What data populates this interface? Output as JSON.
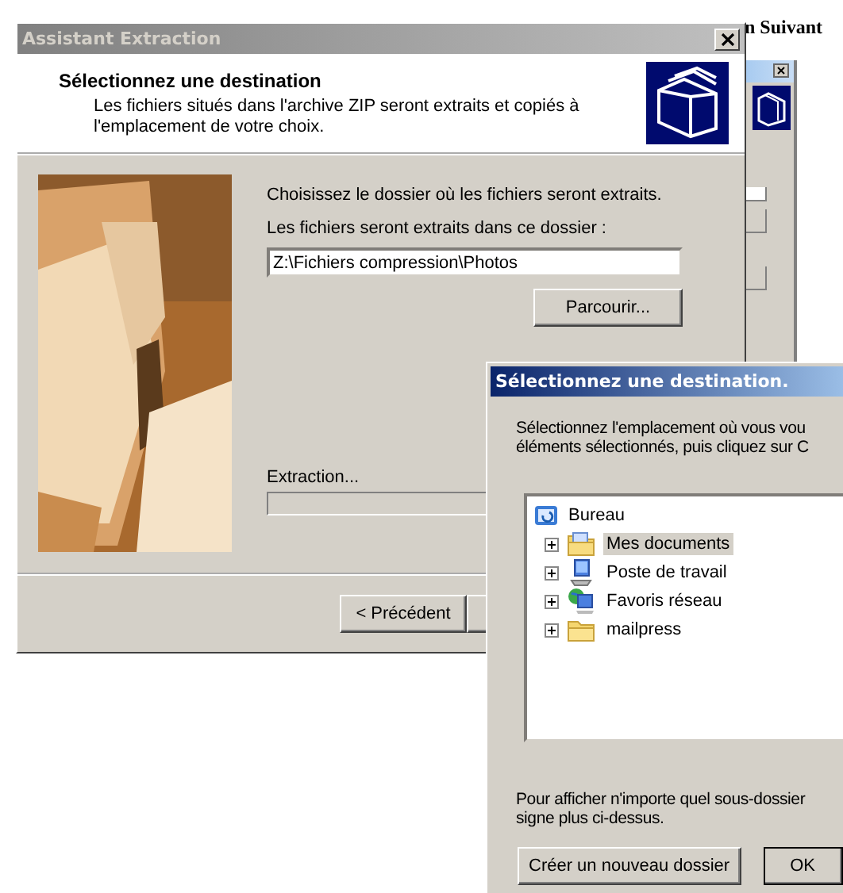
{
  "page_text": "n Suivant",
  "back_window": {
    "kind": "window"
  },
  "wizard": {
    "title": "Assistant Extraction",
    "header": {
      "title": "Sélectionnez une destination",
      "subtitle": "Les fichiers situés dans l'archive ZIP seront extraits et copiés à l'emplacement de votre choix."
    },
    "prompt": "Choisissez le dossier où les fichiers seront extraits.",
    "folder_label": "Les fichiers seront extraits dans ce dossier :",
    "folder_value": "Z:\\Fichiers compression\\Photos",
    "browse_button": "Parcourir...",
    "progress": {
      "label": "Extraction...",
      "level": 0
    },
    "buttons": [
      "< Précédent"
    ]
  },
  "dialog": {
    "title": "Sélectionnez une destination.",
    "instructions": [
      "Sélectionnez l'emplacement où vous vou",
      "éléments sélectionnés, puis cliquez sur C"
    ],
    "tree": [
      {
        "label": "Bureau",
        "kind": "desktop",
        "selected": false,
        "children": [
          {
            "label": "Mes documents",
            "kind": "documents",
            "selected": true,
            "expanded": false
          },
          {
            "label": "Poste de travail",
            "kind": "computer",
            "selected": false,
            "expanded": false
          },
          {
            "label": "Favoris réseau",
            "kind": "network",
            "selected": false,
            "expanded": false
          },
          {
            "label": "mailpress",
            "kind": "folder",
            "selected": false,
            "expanded": false
          }
        ]
      }
    ],
    "hint": [
      "Pour afficher n'importe quel sous-dossier",
      "signe plus ci-dessus."
    ],
    "buttons": [
      "Créer un nouveau dossier",
      "OK"
    ]
  }
}
